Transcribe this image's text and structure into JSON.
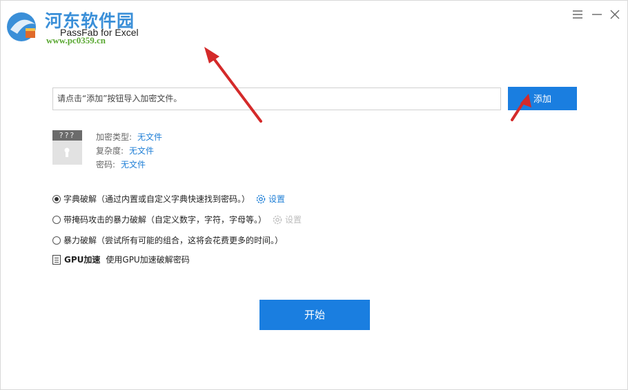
{
  "watermark": {
    "site_name": "河东软件园",
    "url": "www.pc0359.cn"
  },
  "app": {
    "title": "PassFab for Excel"
  },
  "file": {
    "placeholder": "请点击“添加”按钮导入加密文件。",
    "add_label": "添加",
    "thumb_text": "???",
    "encryption_type_label": "加密类型:",
    "encryption_type_value": "无文件",
    "complexity_label": "复杂度:",
    "complexity_value": "无文件",
    "password_label": "密码:",
    "password_value": "无文件"
  },
  "options": {
    "dictionary": {
      "label": "字典破解（通过内置或自定义字典快速找到密码。）",
      "settings": "设置",
      "selected": true
    },
    "mask": {
      "label": "带掩码攻击的暴力破解（自定义数字，字符，字母等。）",
      "settings": "设置",
      "selected": false
    },
    "brute": {
      "label": "暴力破解（尝试所有可能的组合，这将会花费更多的时间。）",
      "selected": false
    },
    "gpu": {
      "title": "GPU加速",
      "desc": "使用GPU加速破解密码"
    }
  },
  "start_label": "开始",
  "colors": {
    "accent": "#1a7ee0",
    "link": "#1f7fd6",
    "arrow": "#d42a2a"
  }
}
